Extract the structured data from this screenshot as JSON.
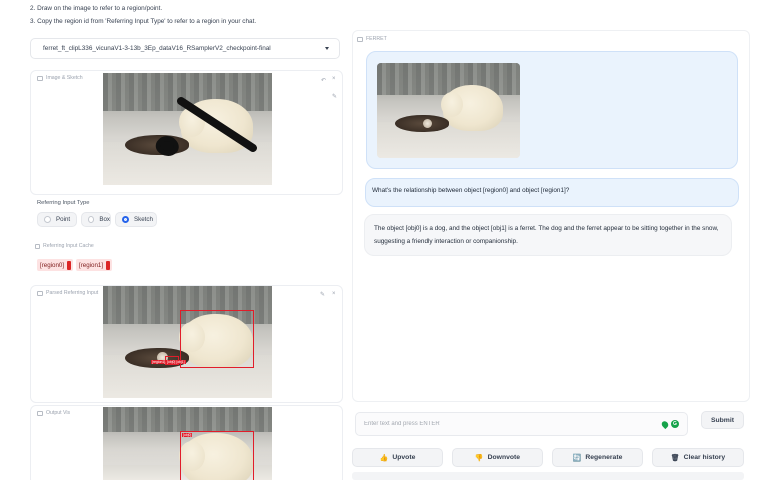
{
  "instructions": [
    "2. Draw on the image to refer to a region/point.",
    "3. Copy the region id from 'Referring Input Type' to refer to a region in your chat."
  ],
  "model_select": {
    "value": "ferret_ft_clipL336_vicunaV1-3-13b_3Ep_dataV16_RSamplerV2_checkpoint-final"
  },
  "image_sketch": {
    "label": "Image & Sketch",
    "undo_icon": "↶",
    "close_icon": "×",
    "edit_icon": "✎"
  },
  "referring_input": {
    "label": "Referring Input Type",
    "options": [
      {
        "label": "Point",
        "selected": false
      },
      {
        "label": "Box",
        "selected": false
      },
      {
        "label": "Sketch",
        "selected": true
      }
    ]
  },
  "cache": {
    "label": "Referring Input Cache",
    "tags": [
      "[region0]",
      "[region1]"
    ]
  },
  "parsed": {
    "label": "Parsed Referring Input",
    "edit_icon": "✎",
    "close_icon": "×",
    "box_tag": "[region1], [obj0] [obj1]"
  },
  "output_vis": {
    "label": "Output Vis",
    "box_tag": "[obj0]"
  },
  "chat": {
    "label": "FERRET",
    "user_message": "What's the relationship between object [region0] and object [region1]?",
    "bot_message": "The object [obj0] is a dog, and the object [obj1] is a ferret. The dog and the ferret appear to be sitting together in the snow, suggesting a friendly interaction or companionship."
  },
  "input": {
    "placeholder": "Enter text and press ENTER",
    "value": "",
    "grammar_icon": "G"
  },
  "buttons": {
    "submit": "Submit",
    "upvote": "Upvote",
    "upvote_icon": "👍",
    "downvote": "Downvote",
    "downvote_icon": "👎",
    "regenerate": "Regenerate",
    "regenerate_icon": "🔄",
    "clear": "Clear history",
    "clear_icon": "🗑"
  },
  "colors": {
    "accent": "#2563eb",
    "region": "#e11d2a",
    "bubble": "#eaf3fd"
  }
}
